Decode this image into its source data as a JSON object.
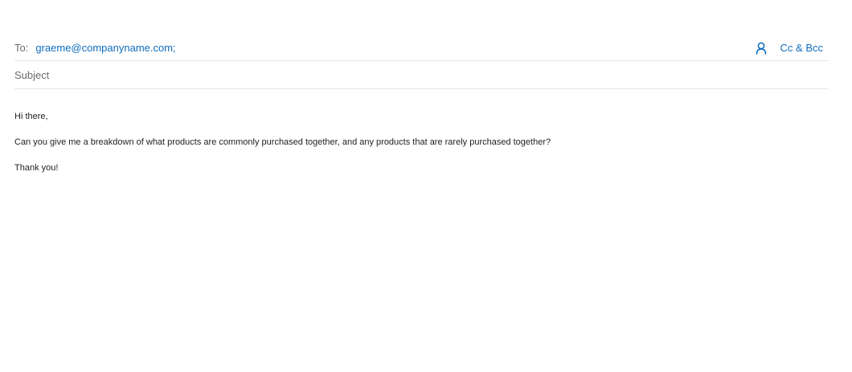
{
  "compose": {
    "to_label": "To:",
    "recipient": "graeme@companyname.com;",
    "add_people_icon": "person-icon",
    "cc_bcc_label": "Cc & Bcc",
    "subject_placeholder": "Subject",
    "body": {
      "greeting": "Hi there,",
      "message": "Can you give me a breakdown of what products are commonly purchased together, and any products that are rarely purchased together?",
      "signoff": "Thank you!"
    }
  },
  "colors": {
    "accent": "#0f6cbd",
    "label": "#6b6b6b",
    "divider": "#e6e6e6"
  }
}
